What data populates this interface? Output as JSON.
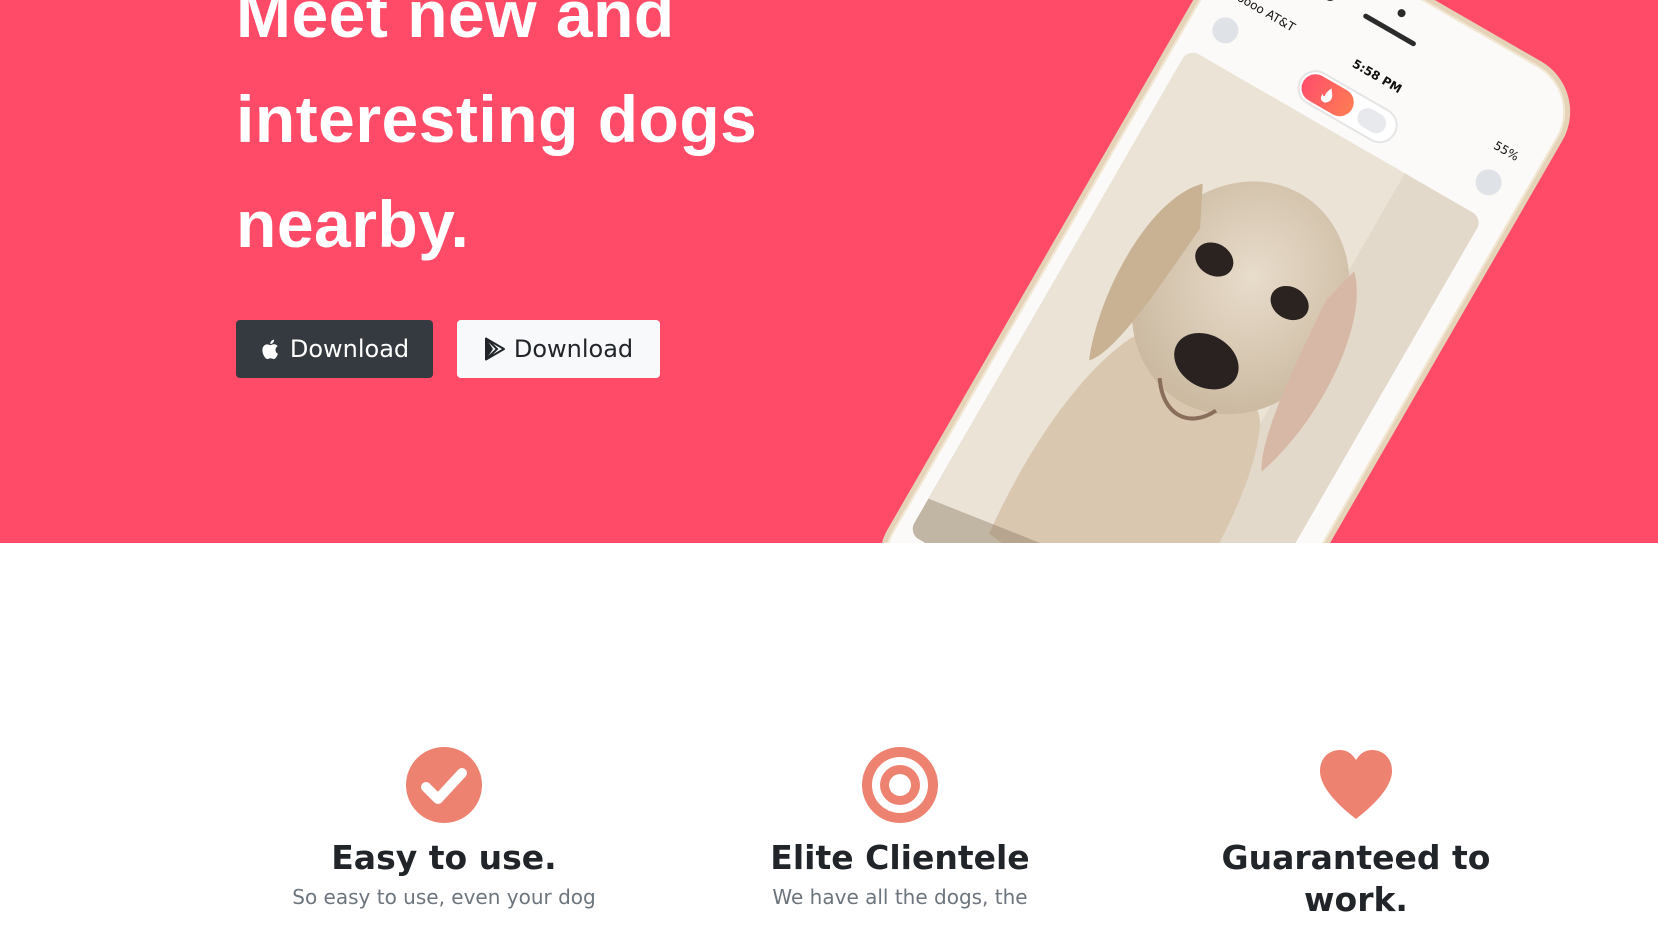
{
  "colors": {
    "hero_background": "#ff4a68",
    "feature_icon": "#ee8270",
    "apple_button": "#343a40",
    "play_button": "#f8f9fa"
  },
  "hero": {
    "headline": "Meet new and interesting dogs nearby.",
    "buttons": [
      {
        "label": "Download",
        "icon": "apple-icon"
      },
      {
        "label": "Download",
        "icon": "google-play-icon"
      }
    ]
  },
  "phone": {
    "carrier": "•oooo AT&T",
    "time": "5:58 PM",
    "battery": "55%"
  },
  "features": [
    {
      "icon": "check-circle-icon",
      "title": "Easy to use.",
      "text": "So easy to use, even your dog"
    },
    {
      "icon": "target-icon",
      "title": "Elite Clientele",
      "text": "We have all the dogs, the"
    },
    {
      "icon": "heart-icon",
      "title": "Guaranteed to work.",
      "text": ""
    }
  ]
}
